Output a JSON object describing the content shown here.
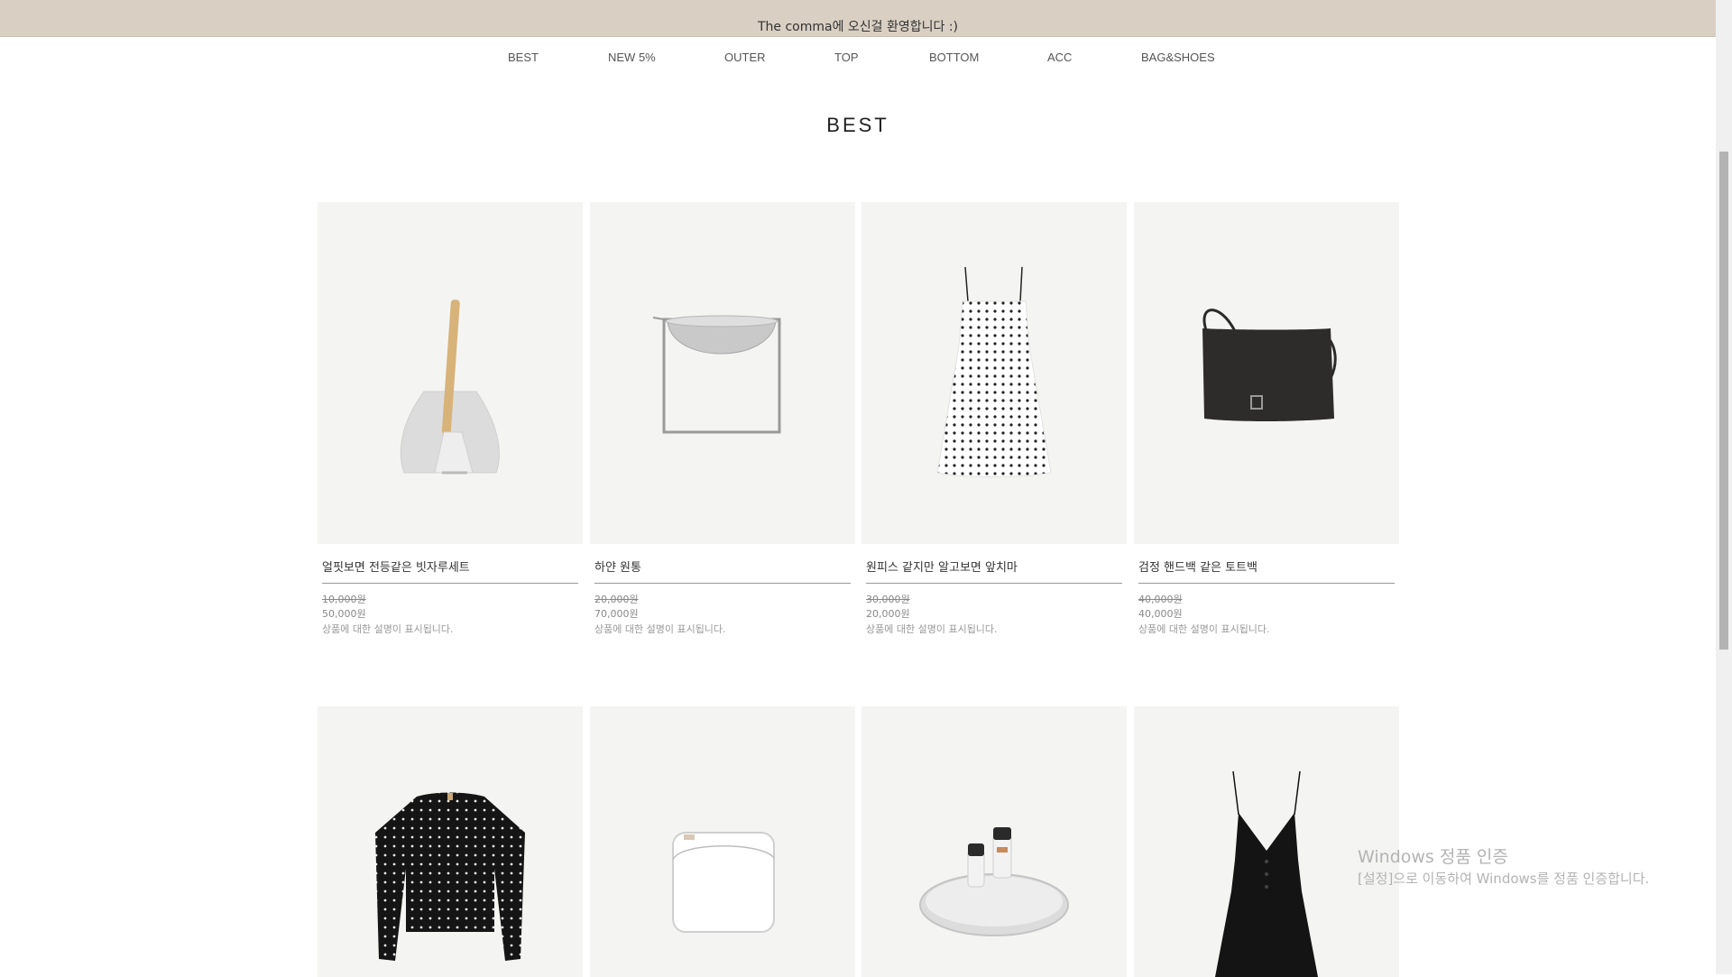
{
  "topbar": {
    "text": "The comma에 오신걸 환영합니다 :)",
    "bg_color": "#d9cfc3"
  },
  "nav": {
    "items": [
      {
        "label": "BEST"
      },
      {
        "label": "NEW 5%"
      },
      {
        "label": "OUTER"
      },
      {
        "label": "TOP"
      },
      {
        "label": "BOTTOM"
      },
      {
        "label": "ACC"
      },
      {
        "label": "BAG&SHOES"
      }
    ]
  },
  "section": {
    "title": "BEST"
  },
  "products": [
    {
      "name": "얼핏보면 전등같은 빗자루세트",
      "old_price": "10,000원",
      "price": "50,000원",
      "desc": "상품에 대한 설명이 표시됩니다.",
      "image": "brush-dustpan"
    },
    {
      "name": "하얀 원통",
      "old_price": "20,000원",
      "price": "70,000원",
      "desc": "상품에 대한 설명이 표시됩니다.",
      "image": "bowl-stand"
    },
    {
      "name": "원피스 같지만 알고보면 앞치마",
      "old_price": "30,000원",
      "price": "20,000원",
      "desc": "상품에 대한 설명이 표시됩니다.",
      "image": "polka-dress"
    },
    {
      "name": "검정 핸드백 같은 토트백",
      "old_price": "40,000원",
      "price": "40,000원",
      "desc": "상품에 대한 설명이 표시됩니다.",
      "image": "black-handbag"
    },
    {
      "image": "polka-blouse"
    },
    {
      "image": "white-wallet"
    },
    {
      "image": "tray-bottles"
    },
    {
      "image": "black-romper"
    }
  ],
  "watermark": {
    "title": "Windows 정품 인증",
    "subtitle": "[설정]으로 이동하여 Windows를 정품 인증합니다."
  }
}
